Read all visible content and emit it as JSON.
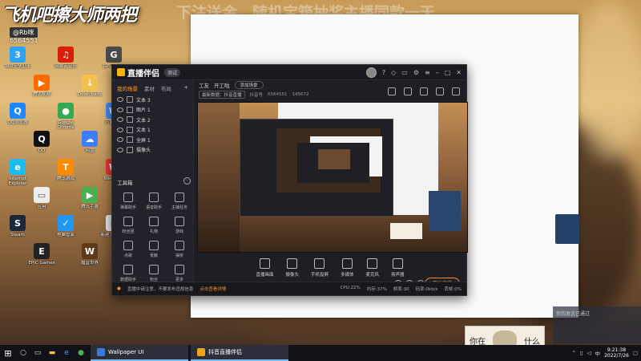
{
  "overlay": {
    "banner_text": "飞机吧擦大师两把",
    "banner_text2": "下注送金，随机宝箱抽奖主播同款一天",
    "username": "@Rb咪",
    "user_id": "6564551",
    "camera_caption_left": "你在",
    "camera_caption_right": "什么"
  },
  "desktop_icons": [
    {
      "label": "360安全卫士",
      "color": "#2ea3f2",
      "glyph": "3"
    },
    {
      "label": "腾讯视频",
      "color": "#ff6a00",
      "glyph": "▶"
    },
    {
      "label": "网易云音乐",
      "color": "#d81e06",
      "glyph": "♫"
    },
    {
      "label": "Downloads",
      "color": "#f2c14e",
      "glyph": "↓"
    },
    {
      "label": "GPU Caps",
      "color": "#4a4a4a",
      "glyph": "G"
    },
    {
      "label": "QQ浏览器",
      "color": "#1f87ff",
      "glyph": "Q"
    },
    {
      "label": "QQ",
      "color": "#111111",
      "glyph": "Q"
    },
    {
      "label": "Google Chrome",
      "color": "#34a853",
      "glyph": "●"
    },
    {
      "label": "网盘",
      "color": "#3d7eff",
      "glyph": "☁"
    },
    {
      "label": "万能输入",
      "color": "#4b8bf4",
      "glyph": "W"
    },
    {
      "label": "Internet Explorer",
      "color": "#1ebbee",
      "glyph": "e"
    },
    {
      "label": "应用",
      "color": "#eeeeee",
      "glyph": "▭"
    },
    {
      "label": "腾讯游戏",
      "color": "#ff8a00",
      "glyph": "T"
    },
    {
      "label": "腾讯手游",
      "color": "#4caf50",
      "glyph": "▶"
    },
    {
      "label": "WeGame",
      "color": "#e53935",
      "glyph": "W"
    },
    {
      "label": "Steam",
      "color": "#1b2838",
      "glyph": "S"
    },
    {
      "label": "EPIC Games",
      "color": "#222222",
      "glyph": "E"
    },
    {
      "label": "电脑管家",
      "color": "#2196f3",
      "glyph": "✓"
    },
    {
      "label": "魔兽世界",
      "color": "#5c3a1a",
      "glyph": "W"
    },
    {
      "label": "新建文本文档",
      "color": "#eeeeee",
      "glyph": "≡"
    }
  ],
  "app": {
    "title": "直播伴侣",
    "badge": "测试",
    "tabs": [
      "我的场景",
      "素材",
      "布局"
    ],
    "layers": [
      "文本 3",
      "图片 1",
      "文本 2",
      "文本 1",
      "全屏 1",
      "摄像头"
    ],
    "toolbox_title": "工具箱",
    "tools": [
      "弹幕助手",
      "语音助手",
      "主播任务",
      "粉丝团",
      "礼物",
      "游戏",
      "点歌",
      "贡献",
      "抽奖",
      "数据助手",
      "粉丝",
      "更多"
    ],
    "scene_label": "工友",
    "scene_select": "开工啦",
    "scene_btn": "添加场景",
    "info_pills": [
      "最新数据：抖音直播",
      "抖音号",
      "6564551",
      "145672"
    ],
    "controls": [
      "直播画面",
      "摄像头",
      "手机投屏",
      "多媒体",
      "麦克风",
      "扬声器"
    ],
    "go_live": "开始直播",
    "status_warning": "直播中请注意，不要发布违规信息",
    "status_link": "点击查看详情",
    "stats": [
      "CPU:22%",
      "内存:37%",
      "帧率:30",
      "码率:0kb/s",
      "丢帧:0%"
    ]
  },
  "notification": {
    "title": "你的发言已通过",
    "body": "..."
  },
  "taskbar": {
    "apps": [
      {
        "label": "Wallpaper UI"
      },
      {
        "label": "抖音直播伴侣"
      }
    ],
    "time": "9:21:38",
    "date": "2022/7/26",
    "lang": "中"
  }
}
